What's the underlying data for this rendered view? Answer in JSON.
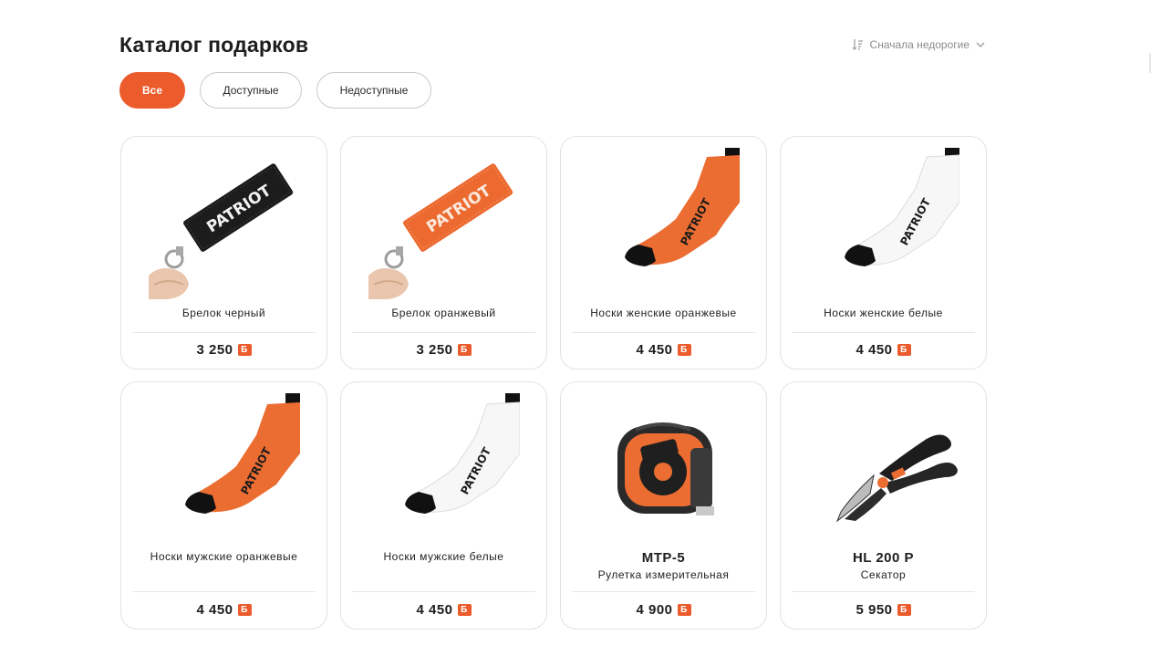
{
  "page": {
    "title": "Каталог подарков"
  },
  "sort": {
    "label": "Сначала недорогие",
    "icon": "sort-icon",
    "chevron": "chevron-down-icon"
  },
  "filters": [
    {
      "label": "Все",
      "active": true
    },
    {
      "label": "Доступные",
      "active": false
    },
    {
      "label": "Недоступные",
      "active": false
    }
  ],
  "currency": {
    "symbol": "Б",
    "color": "#ec5b2c"
  },
  "accent_color": "#ec5b2c",
  "products": [
    {
      "model": "",
      "name": "Брелок черный",
      "price": "3 250",
      "image": "keychain-black"
    },
    {
      "model": "",
      "name": "Брелок оранжевый",
      "price": "3 250",
      "image": "keychain-orange"
    },
    {
      "model": "",
      "name": "Носки женские оранжевые",
      "price": "4 450",
      "image": "sock-orange"
    },
    {
      "model": "",
      "name": "Носки женские белые",
      "price": "4 450",
      "image": "sock-white"
    },
    {
      "model": "",
      "name": "Носки мужские оранжевые",
      "price": "4 450",
      "image": "sock-orange"
    },
    {
      "model": "",
      "name": "Носки мужские белые",
      "price": "4 450",
      "image": "sock-white"
    },
    {
      "model": "MTP-5",
      "name": "Рулетка измерительная",
      "price": "4 900",
      "image": "tape-measure"
    },
    {
      "model": "HL 200 P",
      "name": "Секатор",
      "price": "5 950",
      "image": "pruner"
    }
  ],
  "brand_text": {
    "keychain": "PATRIOT",
    "sock": "PATRIOT"
  }
}
